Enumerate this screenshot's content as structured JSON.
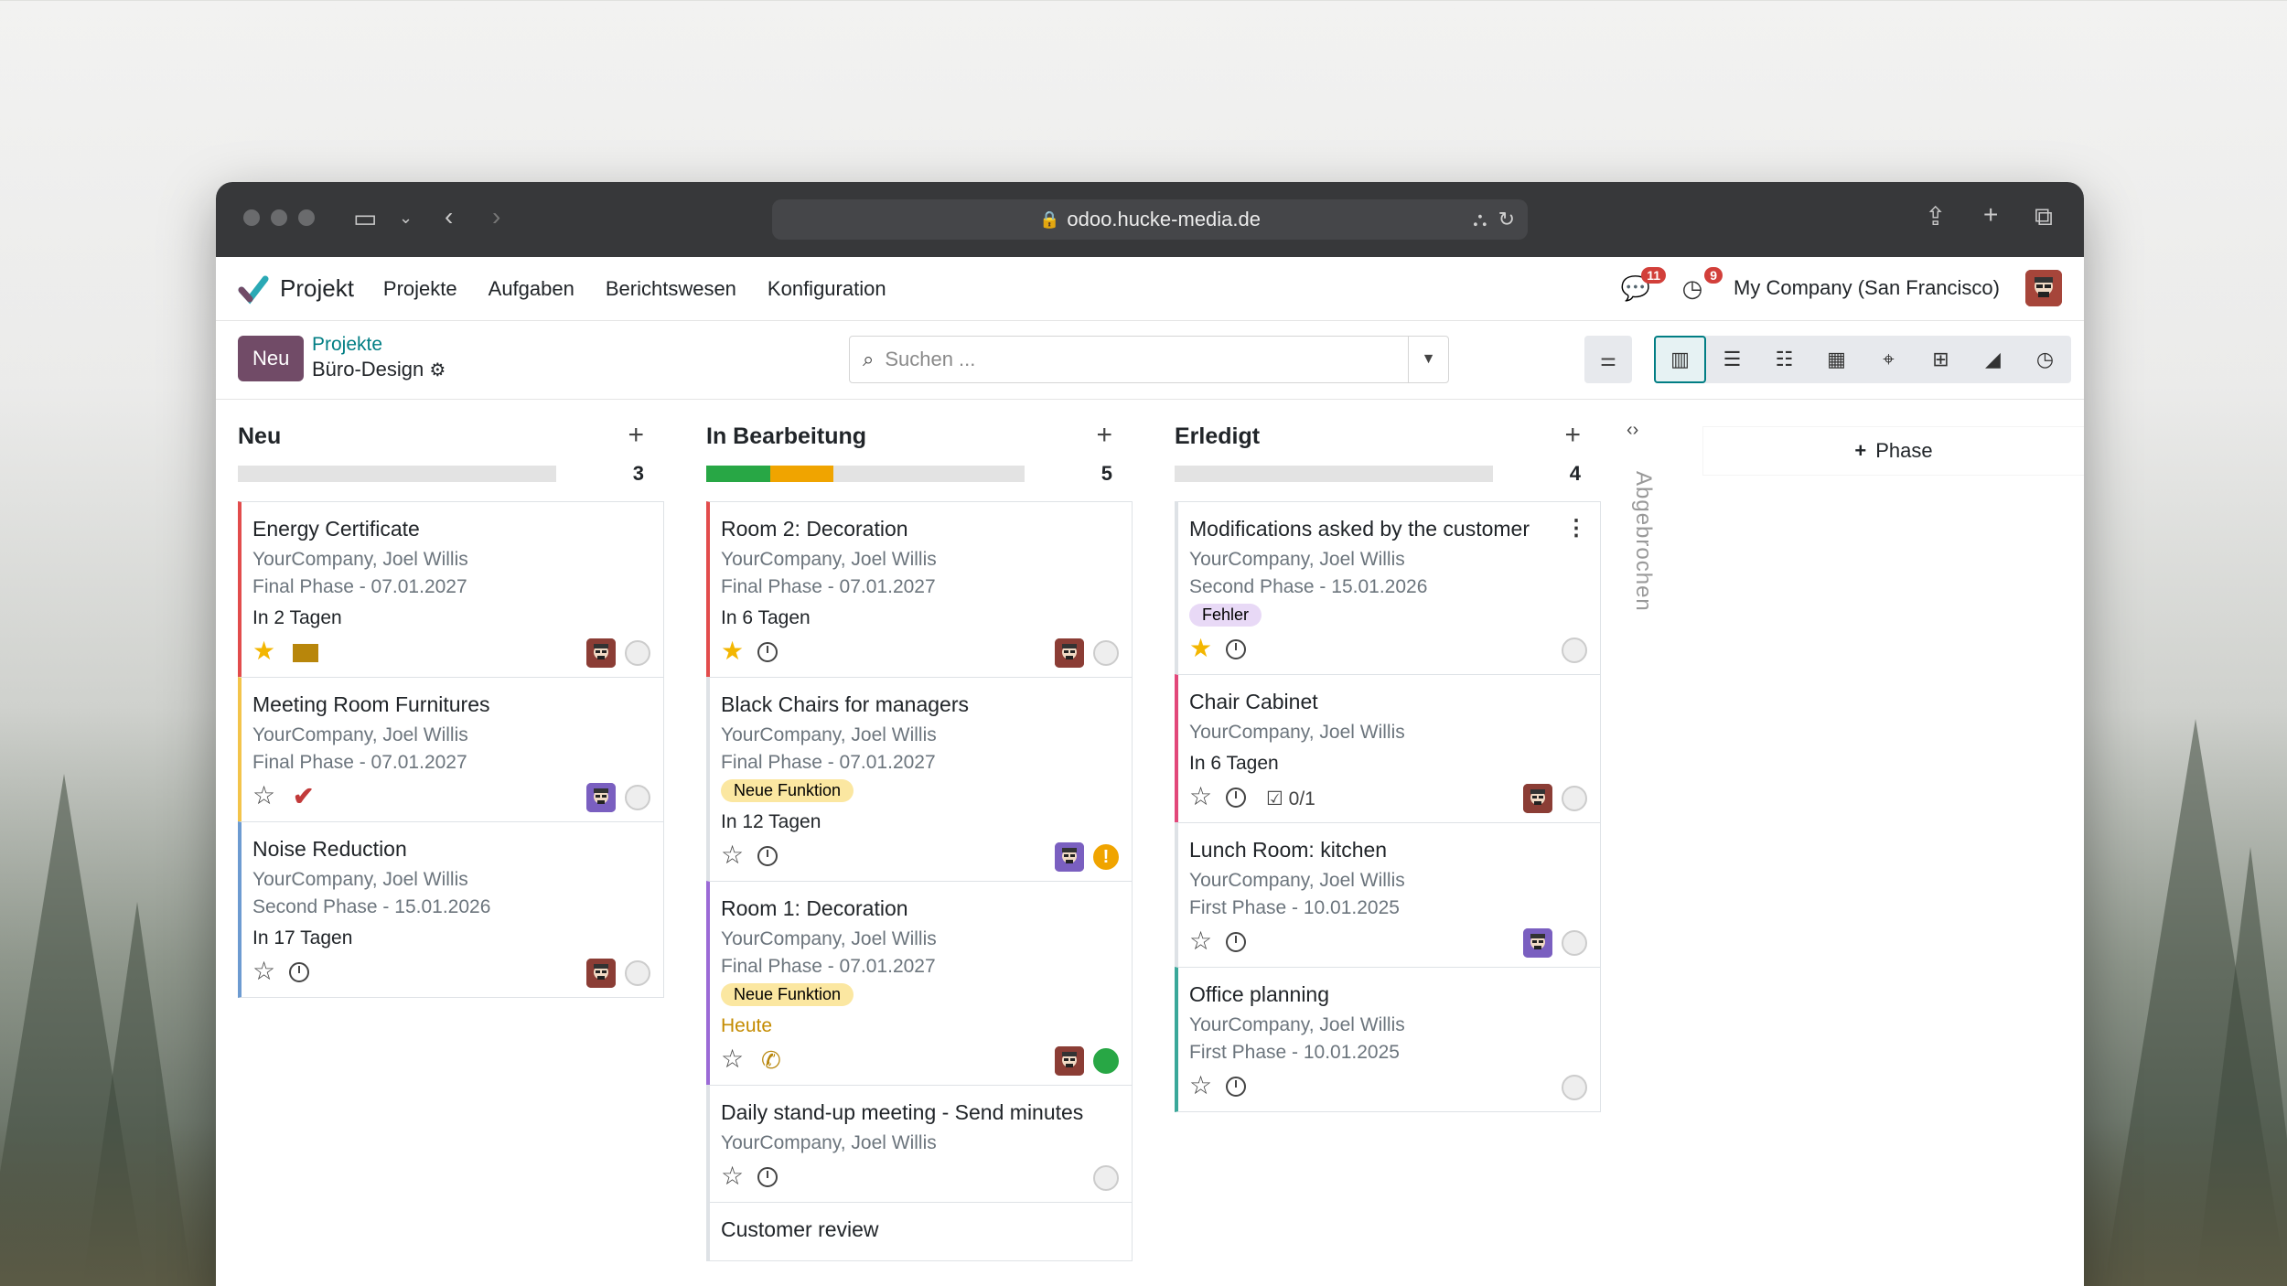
{
  "browser": {
    "url": "odoo.hucke-media.de"
  },
  "navbar": {
    "app_name": "Projekt",
    "menu": [
      "Projekte",
      "Aufgaben",
      "Berichtswesen",
      "Konfiguration"
    ],
    "messages_count": "11",
    "activities_count": "9",
    "company": "My Company (San Francisco)"
  },
  "control": {
    "new_label": "Neu",
    "breadcrumb_parent": "Projekte",
    "breadcrumb_current": "Büro-Design",
    "search_placeholder": "Suchen ..."
  },
  "columns": [
    {
      "title": "Neu",
      "count": "3",
      "progress": [],
      "cards": [
        {
          "title": "Energy Certificate",
          "sub": "YourCompany, Joel Willis",
          "phase": "Final Phase - 07.01.2027",
          "deadline": "In 2 Tagen",
          "accent": "#e24c4c",
          "starred": true,
          "activity": "mail",
          "avatar": "red",
          "state": "grey"
        },
        {
          "title": "Meeting Room Furnitures",
          "sub": "YourCompany, Joel Willis",
          "phase": "Final Phase - 07.01.2027",
          "deadline": "",
          "accent": "#f3c44b",
          "starred": false,
          "activity": "check",
          "avatar": "purple",
          "state": "grey"
        },
        {
          "title": "Noise Reduction",
          "sub": "YourCompany, Joel Willis",
          "phase": "Second Phase - 15.01.2026",
          "deadline": "In 17 Tagen",
          "accent": "#6d9bd1",
          "starred": false,
          "activity": "clock",
          "avatar": "red",
          "state": "grey"
        }
      ]
    },
    {
      "title": "In Bearbeitung",
      "count": "5",
      "progress": [
        {
          "color": "#28a745",
          "pct": 20
        },
        {
          "color": "#f0a400",
          "pct": 20
        }
      ],
      "cards": [
        {
          "title": "Room 2: Decoration",
          "sub": "YourCompany, Joel Willis",
          "phase": "Final Phase - 07.01.2027",
          "deadline": "In 6 Tagen",
          "accent": "#e24c4c",
          "starred": true,
          "activity": "clock",
          "avatar": "red",
          "state": "grey"
        },
        {
          "title": "Black Chairs for managers",
          "sub": "YourCompany, Joel Willis",
          "phase": "Final Phase - 07.01.2027",
          "tag": "Neue Funktion",
          "deadline": "In 12 Tagen",
          "accent": "#ffffff",
          "starred": false,
          "activity": "clock",
          "avatar": "purple",
          "state": "orange"
        },
        {
          "title": "Room 1: Decoration",
          "sub": "YourCompany, Joel Willis",
          "phase": "Final Phase - 07.01.2027",
          "tag": "Neue Funktion",
          "deadline": "Heute",
          "accent": "#9b6ad6",
          "starred": false,
          "activity": "phone",
          "avatar": "red",
          "state": "green"
        },
        {
          "title": "Daily stand-up meeting - Send minutes",
          "sub": "YourCompany, Joel Willis",
          "phase": "",
          "deadline": "",
          "accent": "#ffffff",
          "starred": false,
          "activity": "clock",
          "avatar": "",
          "state": "grey"
        },
        {
          "title": "Customer review",
          "sub": "",
          "phase": "",
          "deadline": "",
          "accent": "#ffffff",
          "starred": false,
          "activity": "",
          "avatar": "",
          "state": ""
        }
      ]
    },
    {
      "title": "Erledigt",
      "count": "4",
      "progress": [],
      "cards": [
        {
          "title": "Modifications asked by the customer",
          "sub": "YourCompany, Joel Willis",
          "phase": "Second Phase - 15.01.2026",
          "tag": "Fehler",
          "deadline": "",
          "accent": "#ffffff",
          "starred": true,
          "activity": "clock",
          "avatar": "",
          "state": "grey",
          "kebab": true
        },
        {
          "title": "Chair Cabinet",
          "sub": "YourCompany, Joel Willis",
          "phase": "",
          "deadline": "In 6 Tagen",
          "accent": "#e2487a",
          "starred": false,
          "activity": "clock",
          "subtasks": "0/1",
          "avatar": "red",
          "state": "grey"
        },
        {
          "title": "Lunch Room: kitchen",
          "sub": "YourCompany, Joel Willis",
          "phase": "First Phase - 10.01.2025",
          "deadline": "",
          "accent": "#ffffff",
          "starred": false,
          "activity": "clock",
          "avatar": "purple",
          "state": "grey"
        },
        {
          "title": "Office planning",
          "sub": "YourCompany, Joel Willis",
          "phase": "First Phase - 10.01.2025",
          "deadline": "",
          "accent": "#3aa89a",
          "starred": false,
          "activity": "clock",
          "avatar": "",
          "state": "grey"
        }
      ]
    }
  ],
  "folded_column": "Abgebrochen",
  "add_phase_label": "Phase",
  "tag_colors": {
    "Neue Funktion": "#fbe7a1",
    "Fehler": "#e8d9f6"
  }
}
